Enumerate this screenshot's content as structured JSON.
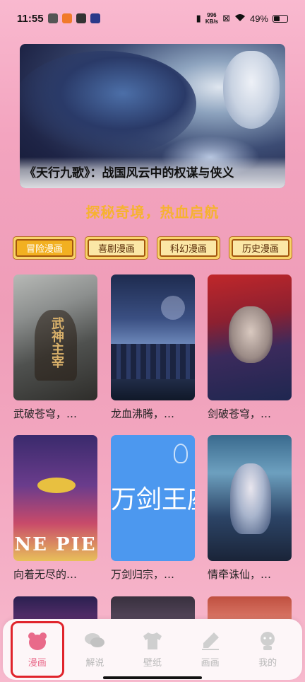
{
  "status_bar": {
    "time": "11:55",
    "net_speed": "996",
    "net_unit": "KB/s",
    "battery": "49%",
    "battery_level": 0.49
  },
  "banner": {
    "title": "《天行九歌》：战国风云中的权谋与侠义"
  },
  "tagline": "探秘奇境，热血启航",
  "categories": [
    {
      "label": "冒险漫画",
      "active": true
    },
    {
      "label": "喜剧漫画",
      "active": false
    },
    {
      "label": "科幻漫画",
      "active": false
    },
    {
      "label": "历史漫画",
      "active": false
    }
  ],
  "comics": [
    {
      "title": "武破苍穹，…",
      "cover_text": "武神主宰"
    },
    {
      "title": "龙血沸腾，…",
      "cover_text": ""
    },
    {
      "title": "剑破苍穹，…",
      "cover_text": ""
    },
    {
      "title": "向着无尽的…",
      "cover_text": "NE PIE"
    },
    {
      "title": "万剑归宗，…",
      "cover_text": "万剑王座"
    },
    {
      "title": "情牵诛仙，…",
      "cover_text": ""
    }
  ],
  "bottom_nav": [
    {
      "label": "漫画",
      "icon": "bear-icon",
      "active": true
    },
    {
      "label": "解说",
      "icon": "chat-icon",
      "active": false
    },
    {
      "label": "壁纸",
      "icon": "shirt-icon",
      "active": false
    },
    {
      "label": "画画",
      "icon": "pen-icon",
      "active": false
    },
    {
      "label": "我的",
      "icon": "profile-icon",
      "active": false
    }
  ],
  "colors": {
    "accent": "#f6b230",
    "nav_active": "#e96a8a",
    "nav_inactive": "#b8b8b8"
  }
}
